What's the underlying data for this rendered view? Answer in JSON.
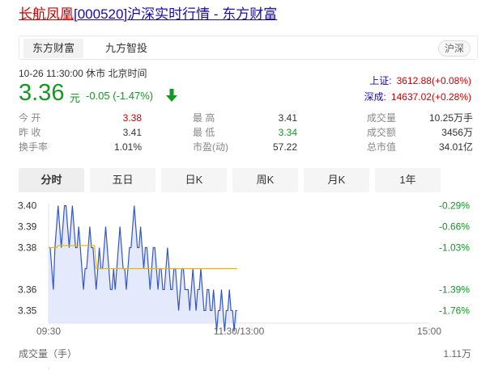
{
  "title": {
    "name": "长航凤凰",
    "code": "[000520]",
    "rest": "沪深实时行情 - 东方财富"
  },
  "tabs": [
    "东方财富",
    "九方智投"
  ],
  "market_badge": "沪深",
  "time_status": "10-26 11:30:00  休市  北京时间",
  "price": "3.36",
  "price_unit": "元",
  "change": "-0.05 (-1.47%)",
  "indices": [
    {
      "name": "上证:",
      "value": "3612.88(+0.08%)"
    },
    {
      "name": "深成:",
      "value": "14637.02(+0.28%)"
    }
  ],
  "quote": {
    "open_label": "今  开",
    "open_value": "3.38",
    "prev_label": "昨  收",
    "prev_value": "3.41",
    "turnover_label": "换手率",
    "turnover_value": "1.01%",
    "high_label": "最  高",
    "high_value": "3.41",
    "low_label": "最  低",
    "low_value": "3.34",
    "pe_label": "市盈(动)",
    "pe_value": "57.22",
    "vol_label": "成交量",
    "vol_value": "10.25万手",
    "amt_label": "成交额",
    "amt_value": "3456万",
    "cap_label": "总市值",
    "cap_value": "34.01亿"
  },
  "period_tabs": [
    "分时",
    "五日",
    "日K",
    "周K",
    "月K",
    "1年"
  ],
  "volume_label": "成交量（手）",
  "volume_max": "1.11万",
  "colors": {
    "up": "#cc0000",
    "down": "#119922",
    "price_line": "#3355cc",
    "avg_line": "#e8b400",
    "link": "#1a0dab"
  },
  "chart_data": {
    "type": "line",
    "x_ticks": [
      "09:30",
      "11:30/13:00",
      "15:00"
    ],
    "y_ticks_left": [
      "3.40",
      "3.39",
      "3.38",
      "3.36",
      "3.35"
    ],
    "y_ticks_right": [
      "-0.29%",
      "-0.66%",
      "-1.03%",
      "-1.39%",
      "-1.76%"
    ],
    "ylim": [
      3.344,
      3.401
    ],
    "session_minutes": 240,
    "series": [
      {
        "values": [
          3.38,
          3.38,
          3.37,
          3.36,
          3.38,
          3.39,
          3.4,
          3.39,
          3.38,
          3.39,
          3.4,
          3.4,
          3.39,
          3.38,
          3.39,
          3.4,
          3.39,
          3.38,
          3.38,
          3.39,
          3.38,
          3.37,
          3.36,
          3.37,
          3.37,
          3.38,
          3.39,
          3.38,
          3.38,
          3.37,
          3.36,
          3.37,
          3.38,
          3.37,
          3.37,
          3.38,
          3.39,
          3.38,
          3.37,
          3.36,
          3.36,
          3.37,
          3.36,
          3.37,
          3.38,
          3.39,
          3.38,
          3.37,
          3.37,
          3.36,
          3.37,
          3.38,
          3.38,
          3.39,
          3.4,
          3.39,
          3.38,
          3.38,
          3.39,
          3.38,
          3.37,
          3.38,
          3.38,
          3.37,
          3.36,
          3.37,
          3.38,
          3.38,
          3.37,
          3.36,
          3.37,
          3.37,
          3.36,
          3.36,
          3.37,
          3.38,
          3.37,
          3.36,
          3.36,
          3.37,
          3.37,
          3.36,
          3.35,
          3.36,
          3.37,
          3.37,
          3.36,
          3.36,
          3.36,
          3.35,
          3.36,
          3.37,
          3.36,
          3.35,
          3.36,
          3.36,
          3.37,
          3.36,
          3.35,
          3.35,
          3.36,
          3.36,
          3.35,
          3.35,
          3.36,
          3.35,
          3.34,
          3.35,
          3.35,
          3.36,
          3.35,
          3.34,
          3.35,
          3.35,
          3.36,
          3.35,
          3.35,
          3.34,
          3.35,
          3.35
        ]
      },
      {
        "values": [
          3.38,
          3.38,
          3.38,
          3.38,
          3.38,
          3.38,
          3.381,
          3.381,
          3.381,
          3.381,
          3.381,
          3.381,
          3.381,
          3.381,
          3.381,
          3.381,
          3.381,
          3.381,
          3.381,
          3.381,
          3.381,
          3.381,
          3.381,
          3.381,
          3.381,
          3.381,
          3.381,
          3.381,
          3.381,
          3.381,
          3.37,
          3.37,
          3.37,
          3.37,
          3.37,
          3.37,
          3.37,
          3.37,
          3.37,
          3.37,
          3.37,
          3.37,
          3.37,
          3.37,
          3.37,
          3.37,
          3.37,
          3.37,
          3.37,
          3.37,
          3.37,
          3.37,
          3.37,
          3.37,
          3.37,
          3.37,
          3.37,
          3.37,
          3.37,
          3.37,
          3.37,
          3.37,
          3.37,
          3.37,
          3.37,
          3.37,
          3.37,
          3.37,
          3.37,
          3.37,
          3.37,
          3.37,
          3.37,
          3.37,
          3.37,
          3.37,
          3.37,
          3.37,
          3.37,
          3.37,
          3.37,
          3.37,
          3.37,
          3.37,
          3.37,
          3.37,
          3.37,
          3.37,
          3.37,
          3.37,
          3.37,
          3.37,
          3.37,
          3.37,
          3.37,
          3.37,
          3.37,
          3.37,
          3.37,
          3.37,
          3.37,
          3.37,
          3.37,
          3.37,
          3.37,
          3.37,
          3.37,
          3.37,
          3.37,
          3.37,
          3.37,
          3.37,
          3.37,
          3.37,
          3.37,
          3.37,
          3.37,
          3.37,
          3.37,
          3.37
        ]
      }
    ]
  }
}
